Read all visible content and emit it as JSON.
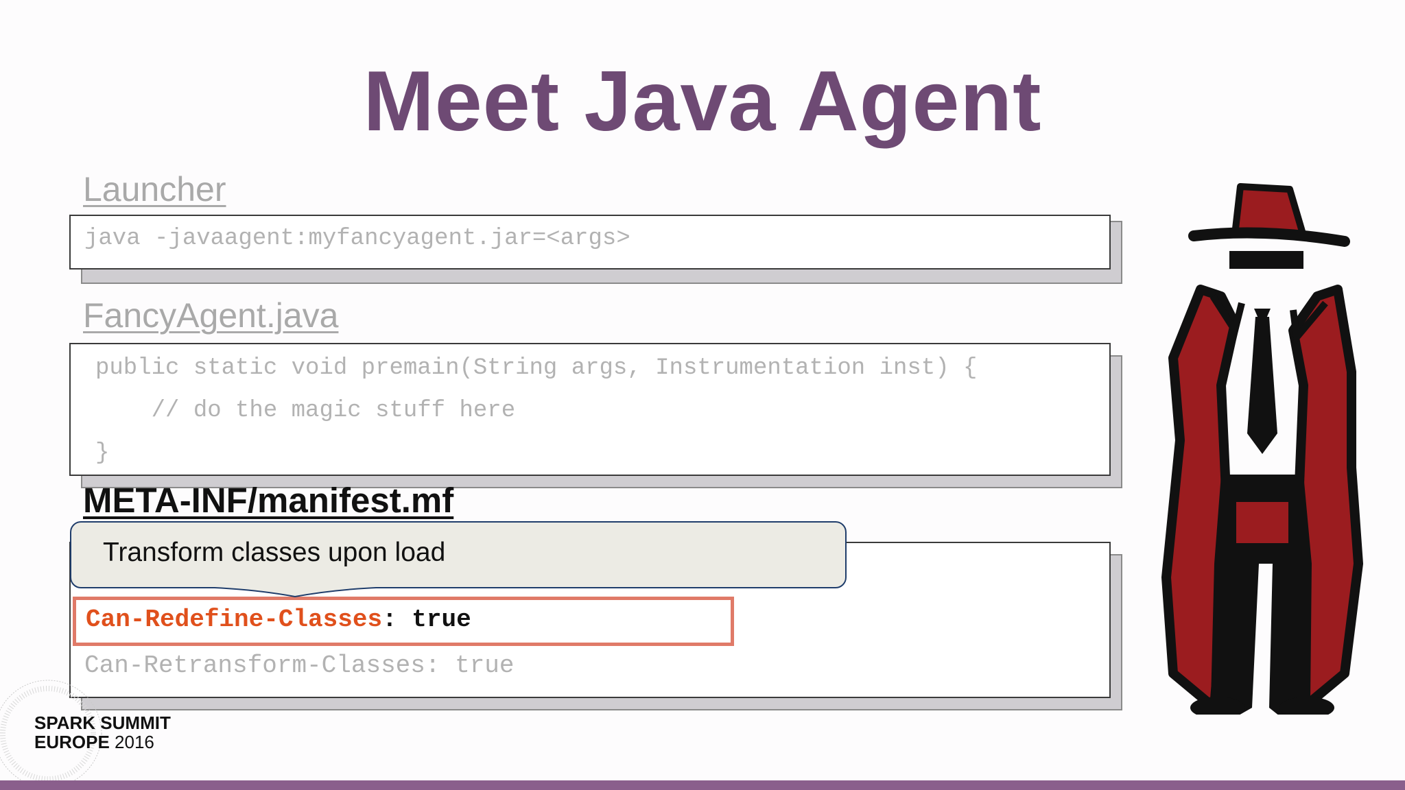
{
  "slide": {
    "title": "Meet Java Agent"
  },
  "sections": {
    "launcher_label": "Launcher",
    "launcher_code": "java -javaagent:myfancyagent.jar=<args>",
    "agent_label": "FancyAgent.java",
    "agent_code": [
      "public static void premain(String args, Instrumentation inst) {",
      "    // do the magic stuff here",
      "}"
    ],
    "manifest_label": "META-INF/manifest.mf",
    "callout": "Transform classes upon load",
    "manifest_highlight_key": "Can-Redefine-Classes",
    "manifest_highlight_sep": ": ",
    "manifest_highlight_value": "true",
    "manifest_line2": "Can-Retransform-Classes: true"
  },
  "footer": {
    "logo_line1": "SPARK SUMMIT",
    "logo_line2": "EUROPE",
    "logo_year": "2016"
  },
  "colors": {
    "title": "#6e4a74",
    "highlight_border": "#e07a68",
    "highlight_key": "#e0501c",
    "footer_bar": "#8a5f8c",
    "agent_red": "#9b1c1f"
  },
  "icons": {
    "agent_figure": "spy-agent-illustration",
    "logo_mark": "spark-summit-logo"
  }
}
